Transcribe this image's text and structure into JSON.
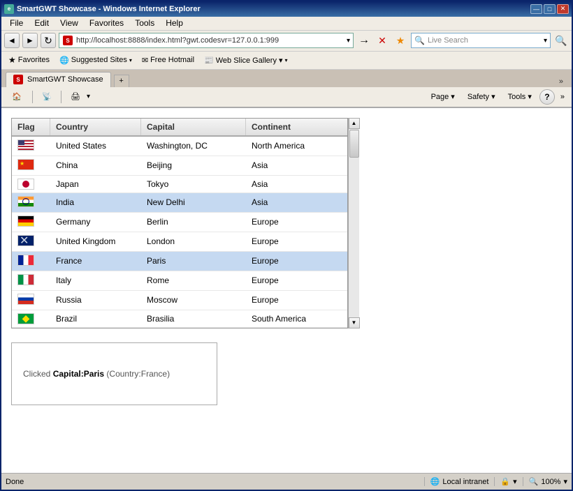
{
  "window": {
    "title": "SmartGWT Showcase - Windows Internet Explorer",
    "min_btn": "—",
    "max_btn": "□",
    "close_btn": "✕"
  },
  "menu": {
    "items": [
      "File",
      "Edit",
      "View",
      "Favorites",
      "Tools",
      "Help"
    ]
  },
  "nav": {
    "back_icon": "◄",
    "forward_icon": "►",
    "reload_icon": "↻",
    "address": "http://localhost:8888/index.html?gwt.codesvr=127.0.0.1:999",
    "go_icon": "→",
    "stop_icon": "✕",
    "refresh_icon": "↻",
    "search_placeholder": "Live Search"
  },
  "favorites_bar": {
    "items": [
      {
        "label": "Favorites",
        "icon": "★"
      },
      {
        "label": "Suggested Sites ▾",
        "icon": "🌐"
      },
      {
        "label": "Free Hotmail",
        "icon": "✉"
      },
      {
        "label": "Web Slice Gallery ▾",
        "icon": "📰"
      }
    ]
  },
  "tab": {
    "label": "SmartGWT Showcase",
    "new_tab": "+"
  },
  "toolbar": {
    "page_label": "Page ▾",
    "safety_label": "Safety ▾",
    "tools_label": "Tools ▾",
    "help_icon": "?"
  },
  "grid": {
    "columns": [
      "Flag",
      "Country",
      "Capital",
      "Continent"
    ],
    "rows": [
      {
        "flag": "us",
        "country": "United States",
        "capital": "Washington, DC",
        "continent": "North America",
        "selected": false
      },
      {
        "flag": "cn",
        "country": "China",
        "capital": "Beijing",
        "continent": "Asia",
        "selected": false
      },
      {
        "flag": "jp",
        "country": "Japan",
        "capital": "Tokyo",
        "continent": "Asia",
        "selected": false
      },
      {
        "flag": "in",
        "country": "India",
        "capital": "New Delhi",
        "continent": "Asia",
        "selected": true
      },
      {
        "flag": "de",
        "country": "Germany",
        "capital": "Berlin",
        "continent": "Europe",
        "selected": false
      },
      {
        "flag": "gb",
        "country": "United Kingdom",
        "capital": "London",
        "continent": "Europe",
        "selected": false
      },
      {
        "flag": "fr",
        "country": "France",
        "capital": "Paris",
        "continent": "Europe",
        "selected": true,
        "highlight": true
      },
      {
        "flag": "it",
        "country": "Italy",
        "capital": "Rome",
        "continent": "Europe",
        "selected": false
      },
      {
        "flag": "ru",
        "country": "Russia",
        "capital": "Moscow",
        "continent": "Europe",
        "selected": false
      },
      {
        "flag": "br",
        "country": "Brazil",
        "capital": "Brasilia",
        "continent": "South America",
        "selected": false
      }
    ]
  },
  "info_box": {
    "prefix": "Clicked ",
    "field": "Capital",
    "value": "Paris",
    "paren": "(Country:France)"
  },
  "status_bar": {
    "status": "Done",
    "zone": "Local intranet",
    "zoom": "100%",
    "zoom_icon": "🔍"
  }
}
